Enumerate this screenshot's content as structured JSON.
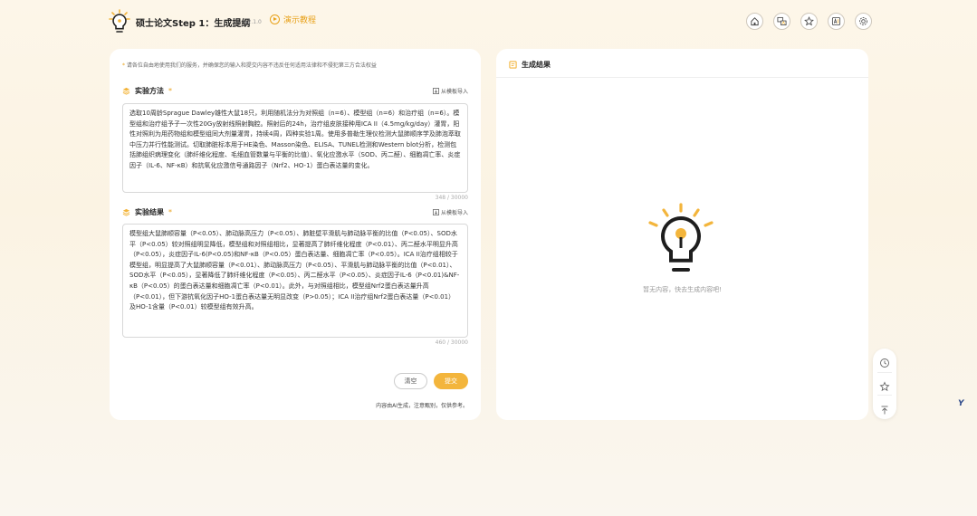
{
  "header": {
    "title": "硕士论文Step 1：生成提纲",
    "version": "v2.1.0",
    "demo_label": "演示教程",
    "icons": [
      "home-icon",
      "translate-icon",
      "star-icon",
      "ai-icon",
      "settings-icon"
    ]
  },
  "notice": {
    "star": "*",
    "text": "请各位自由地使用我们的服务，并确保您的输入和提交内容不违反任何适用法律和不侵犯第三方合法权益"
  },
  "method": {
    "label": "实验方法",
    "required_mark": "*",
    "import_label": "从模板导入",
    "text": "选取10周龄Sprague Dawley雄性大鼠18只，利用随机法分为对照组（n=6）、模型组（n=6）和治疗组（n=6）。模型组和治疗组予子一次性20Gy放射线照射胸腔。照射后的24h，治疗组皮肤接种用ICA II（4.5mg/kg/day）灌胃，阳性对照利为用药物组和模型组同大剂量灌胃，持续4周，四种实验1周。使用多普勒生理仪检测大鼠肺顺序学及肺泡萃取中压力并行性能测试。切取肺脏标本用于HE染色、Masson染色、ELISA、TUNEL检测和Western blot分析，检测包括肺组织病理变化（肺纤维化程度、毛细血管数量与平衡的比值）、氧化应激水平（SOD、丙二醛）、细胞凋亡率、炎症因子（IL-6、NF-κB）和抗氧化应激信号通路因子（Nrf2、HO-1）蛋白表达量的变化。",
    "count": "348 / 30000"
  },
  "result": {
    "label": "实验结果",
    "required_mark": "*",
    "import_label": "从模板导入",
    "text": "模型组大鼠肺顺容量（P<0.05）、肺动脉高压力（P<0.05）、肺脏壁平滑肌与肺动脉平衡的比值（P<0.05）、SOD水平（P<0.05）较对照组明显降低，模型组和对照组相比，显著提高了肺纤维化程度（P<0.01）、丙二醛水平明显升高（P<0.05），炎症因子IL-6(P<0.05)和NF-κB（P<0.05）蛋白表达量、细胞凋亡率（P<0.05）。ICA II治疗组相较于模型组，明显提高了大鼠肺顺容量（P<0.01）、肺动脉高压力（P<0.05）、平滑肌与肺动脉平衡的比值（P<0.01）、SOD水平（P<0.05），显著降低了肺纤维化程度（P<0.05）、丙二醛水平（P<0.05）、炎症因子IL-6（P<0.01)&NF-κB（P<0.05）的蛋白表达量和细胞凋亡率（P<0.01）。此外，与对照组相比，模型组Nrf2蛋白表达量升高（P<0.01），但下游抗氧化因子HO-1蛋白表达量无明显改变（P>0.05）；ICA II治疗组Nrf2蛋白表达量（P<0.01）及HO-1含量（P<0.01）较模型组有效升高。",
    "count": "460 / 30000"
  },
  "actions": {
    "clear_label": "清空",
    "submit_label": "提交",
    "disclaimer": "内容由AI生成，注意甄别，仅供参考。"
  },
  "output": {
    "title": "生成结果",
    "empty_text": "暂无内容，快去生成内容吧!"
  },
  "float_toolbar": {
    "icons": [
      "history-icon",
      "favorite-icon",
      "back-to-top-icon"
    ]
  },
  "corner_logo": "Y",
  "colors": {
    "accent": "#f3b53c",
    "accent_dark": "#e8a21b",
    "background": "#fcf5e8",
    "panel": "#ffffff"
  }
}
